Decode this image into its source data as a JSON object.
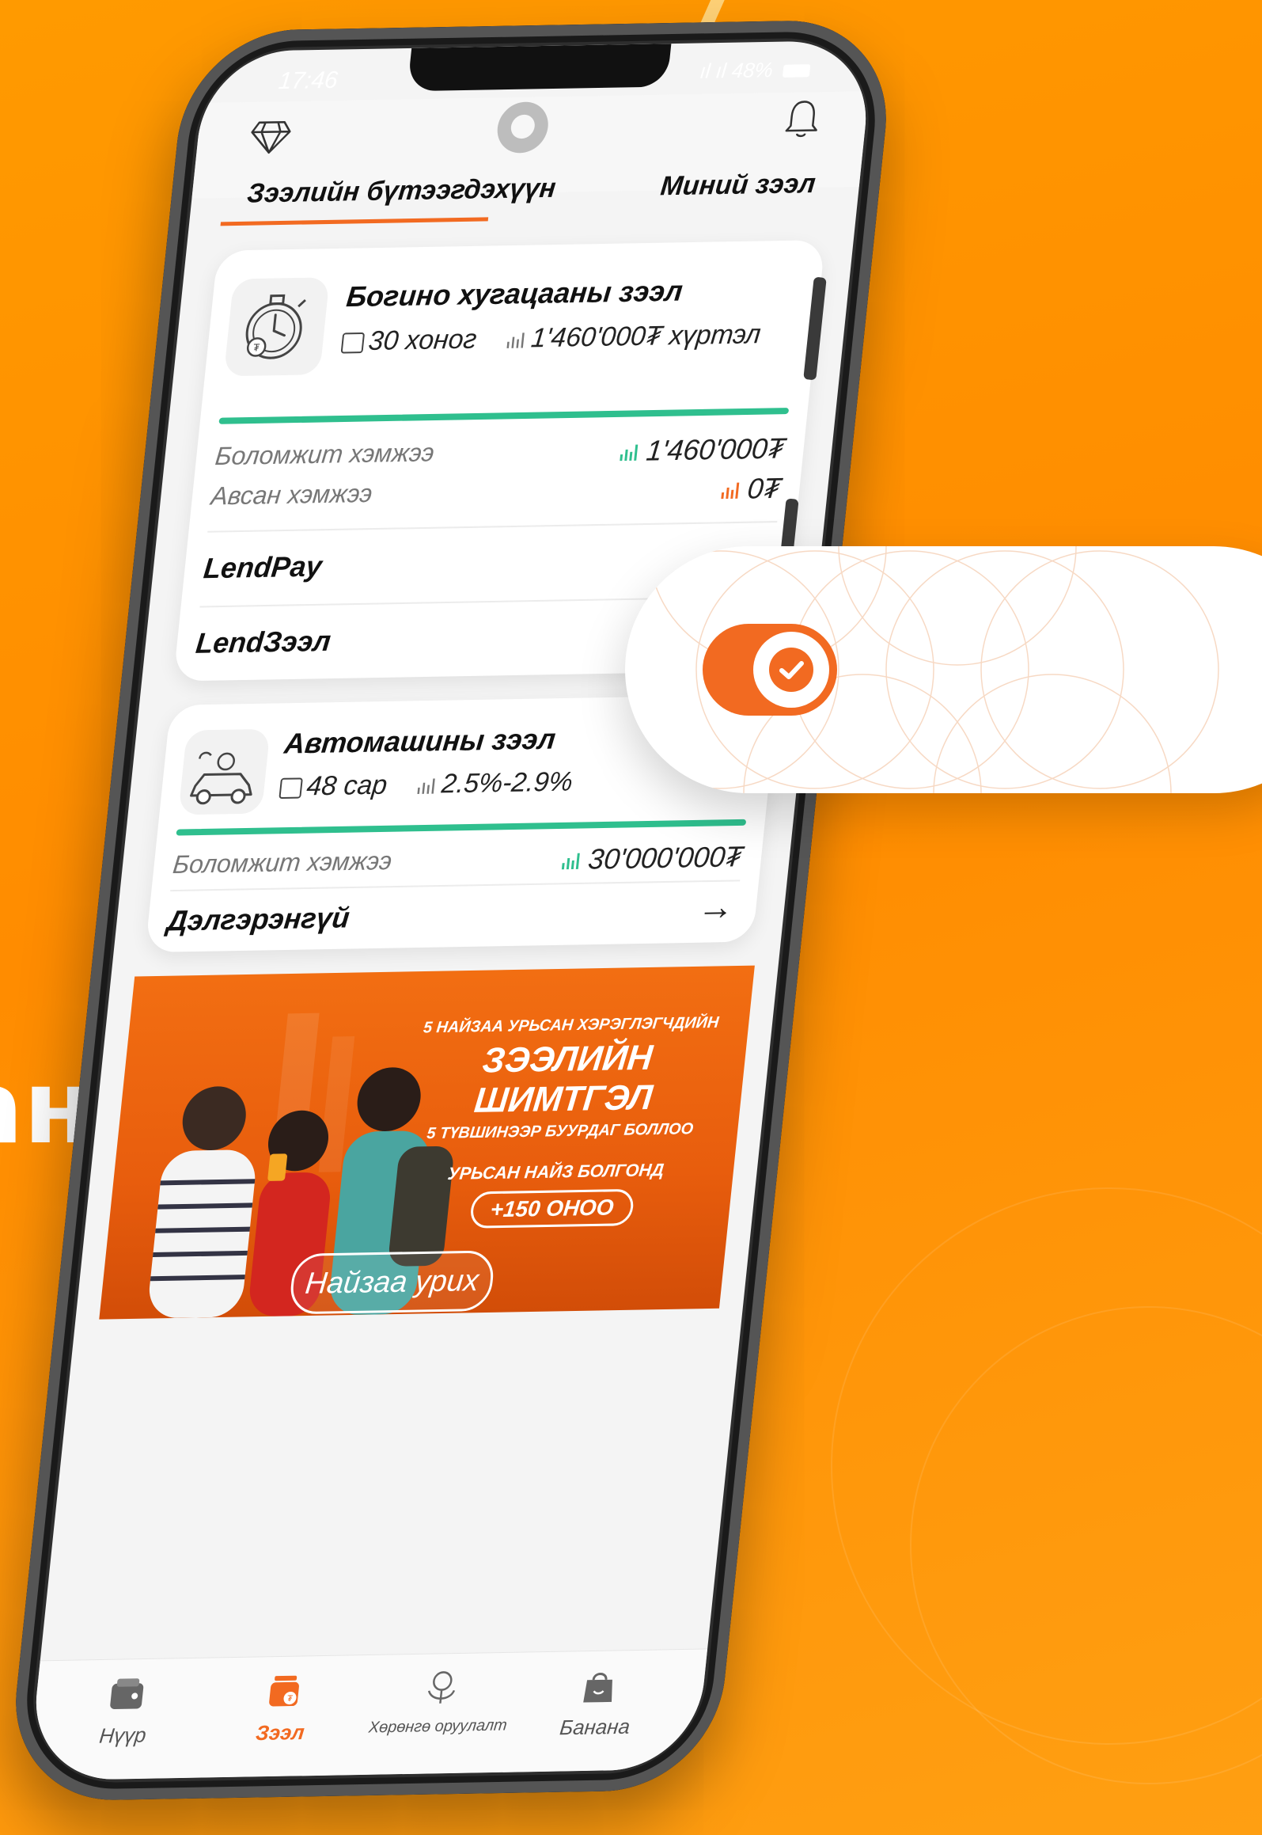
{
  "background_text": "ан",
  "status_bar": {
    "time": "17:46",
    "signal": "ıl ıl",
    "battery": "48%"
  },
  "tabs": {
    "active": "Зээлийн бүтээгдэхүүн",
    "other": "Миний зээл"
  },
  "short_term_loan": {
    "title": "Богино хугацааны зээл",
    "duration": "30 хоног",
    "limit": "1'460'000₮ хүртэл",
    "available_label": "Боломжит хэмжээ",
    "available_value": "1'460'000₮",
    "taken_label": "Авсан хэмжээ",
    "taken_value": "0₮",
    "links": [
      "LendPay",
      "LendЗээл"
    ]
  },
  "car_loan": {
    "title": "Автомашины зээл",
    "duration": "48 сар",
    "rate": "2.5%-2.9%",
    "available_label": "Боломжит хэмжээ",
    "available_value": "30'000'000₮",
    "details_label": "Дэлгэрэнгүй"
  },
  "banner": {
    "line1": "5 НАЙЗАА УРЬСАН ХЭРЭГЛЭГЧДИЙН",
    "line2": "ЗЭЭЛИЙН ШИМТГЭЛ",
    "line3": "5 ТҮВШИНЭЭР БУУРДАГ БОЛЛОО",
    "line4": "УРЬСАН НАЙЗ БОЛГОНД",
    "points": "+150 ОНОО",
    "invite_button": "Найзаа урих"
  },
  "tabbar": [
    {
      "label": "Нүүр",
      "icon": "wallet-icon"
    },
    {
      "label": "Зээл",
      "icon": "loan-icon",
      "active": true
    },
    {
      "label": "Хөрөнгө оруулалт",
      "icon": "investment-icon"
    },
    {
      "label": "Банана",
      "icon": "shopping-bag-icon"
    }
  ],
  "colors": {
    "accent": "#f26a21",
    "progress": "#2fbf8e",
    "background": "#ff8c00"
  }
}
